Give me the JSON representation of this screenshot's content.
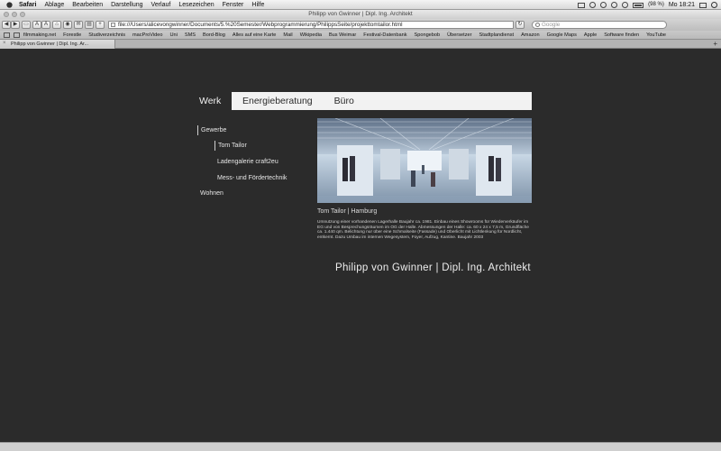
{
  "menubar": {
    "app": "Safari",
    "items": [
      "Ablage",
      "Bearbeiten",
      "Darstellung",
      "Verlauf",
      "Lesezeichen",
      "Fenster",
      "Hilfe"
    ],
    "battery": "(98 %)",
    "clock": "Mo 18:21"
  },
  "window": {
    "title": "Philipp von Gwinner | Dipl. Ing. Architekt"
  },
  "toolbar": {
    "url": "file:///Users/alicevongwinner/Documents/5.%20Semester/Webprogrammierung/PhilippsSeite/projekttomtailor.html",
    "search_placeholder": "Google"
  },
  "bookmarks": [
    "filmmaking.net",
    "Forestle",
    "Studiverzeichnis",
    "macProVideo",
    "Uni",
    "SMS",
    "Bord-Blog",
    "Alles auf eine Karte",
    "Mail",
    "Wikipedia",
    "Bus Weimar",
    "Festival-Datenbank",
    "Spongebob",
    "Übersetzer",
    "Stadtplandienst",
    "Amazon",
    "Google Maps",
    "Apple",
    "Software finden",
    "YouTube"
  ],
  "tab": {
    "label": "Philipp von Gwinner | Dipl. Ing. Ar..."
  },
  "nav": {
    "werk": "Werk",
    "energie": "Energieberatung",
    "buero": "Büro"
  },
  "sidebar": {
    "gewerbe": "Gewerbe",
    "sub": [
      "Tom Tailor",
      "Ladengalerie craft2eu",
      "Mess- und Fördertechnik"
    ],
    "wohnen": "Wohnen"
  },
  "project": {
    "title": "Tom Tailor | Hamburg",
    "description": "Umnutzung einer vorhandenen Lagerhalle Baujahr ca. 1981. Einbau eines Showrooms für Wiederverkäufer im EG und von Besprechungsräumen im OG der Halle. Abmessungen der Halle: ca. 60 x 24 x 7,5 m, Grundfläche ca. 1.440 qm. Belichtung nur über eine Schmalseite (Fassade) und Oberlicht mit Lichtlenkung für Nordlicht, entkernt. Dazu Umbau im internen Wegesystem, Foyer, Aufzug, Kantine. Baujahr 2003"
  },
  "signature": "Philipp von Gwinner | Dipl. Ing. Architekt"
}
